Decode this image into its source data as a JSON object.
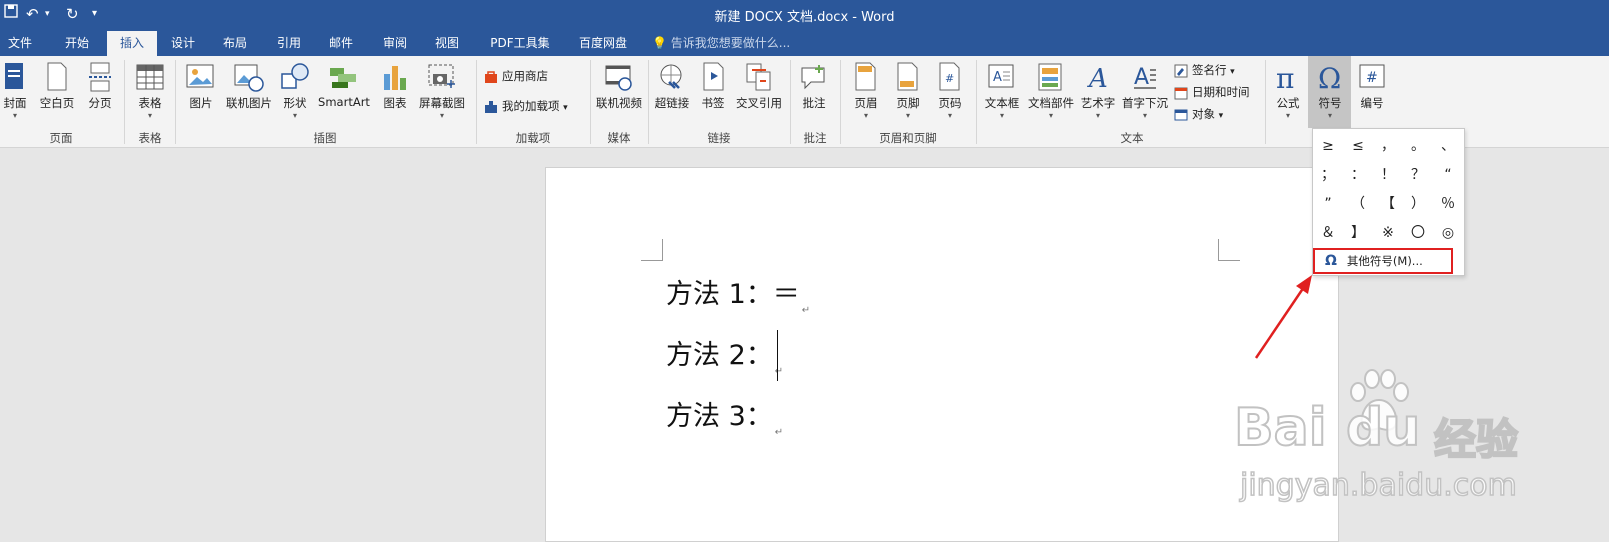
{
  "window": {
    "title": "新建 DOCX 文档.docx - Word",
    "quick_access": [
      "save-icon",
      "undo-icon",
      "redo-icon",
      "customize-icon"
    ]
  },
  "tabs": [
    "文件",
    "开始",
    "插入",
    "设计",
    "布局",
    "引用",
    "邮件",
    "审阅",
    "视图",
    "PDF工具集",
    "百度网盘"
  ],
  "active_tab": "插入",
  "tell_me": "告诉我您想要做什么...",
  "ribbon": {
    "groups": {
      "pages": "页面",
      "tables": "表格",
      "illustrations": "插图",
      "addins": "加载项",
      "media": "媒体",
      "links": "链接",
      "comments": "批注",
      "header_footer": "页眉和页脚",
      "text": "文本"
    },
    "buttons": {
      "cover": "封面",
      "blank_page": "空白页",
      "page_break": "分页",
      "table": "表格",
      "picture": "图片",
      "online_picture": "联机图片",
      "shapes": "形状",
      "smartart": "SmartArt",
      "chart": "图表",
      "screenshot": "屏幕截图",
      "app_store": "应用商店",
      "my_addins": "我的加载项",
      "online_video": "联机视频",
      "hyperlink": "超链接",
      "bookmark": "书签",
      "cross_ref": "交叉引用",
      "comment": "批注",
      "header": "页眉",
      "footer": "页脚",
      "page_number": "页码",
      "text_box": "文本框",
      "quick_parts": "文档部件",
      "wordart": "艺术字",
      "drop_cap": "首字下沉",
      "signature_line": "签名行",
      "date_time": "日期和时间",
      "object": "对象",
      "equation": "公式",
      "symbol": "符号",
      "numbering": "编号"
    }
  },
  "document": {
    "lines": [
      "方法 1：＝",
      "方法 2：",
      "方法 3："
    ],
    "para_mark": "↵"
  },
  "symbol_dropdown": {
    "symbols": [
      "≥",
      "≤",
      "，",
      "。",
      "、",
      "；",
      "：",
      "！",
      "？",
      "“",
      "”",
      "（",
      "【",
      "）",
      "％",
      "＆",
      "】",
      "※",
      "〇",
      "◎"
    ],
    "more_symbols": "其他符号(M)..."
  },
  "watermark": {
    "brand": "Bai",
    "brand2": "du",
    "cn": "经验",
    "url": "jingyan.baidu.com"
  },
  "colors": {
    "accent": "#2b579a",
    "highlight": "#e02020"
  }
}
